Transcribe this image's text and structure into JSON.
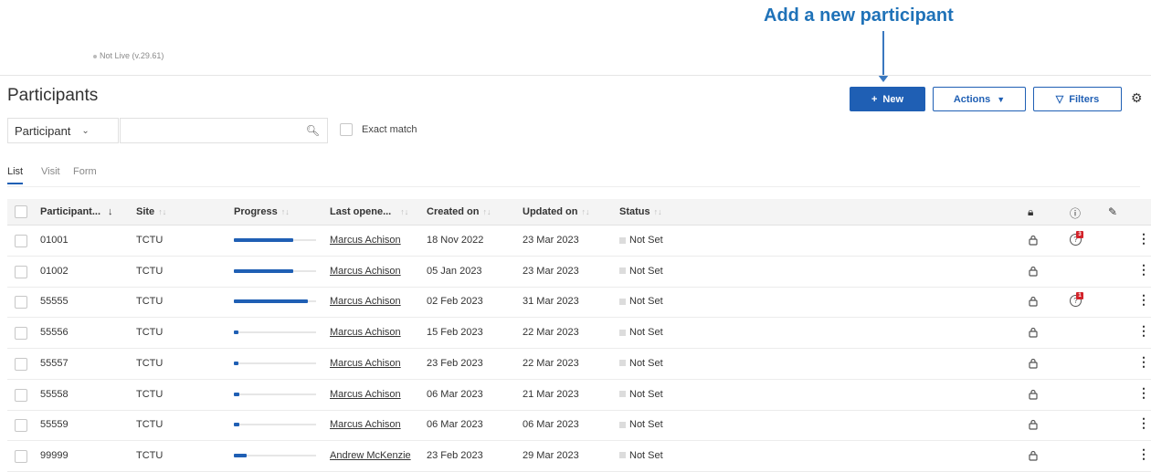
{
  "annotation": {
    "text": "Add a new participant"
  },
  "env": {
    "status": "Not Live (v.29.61)"
  },
  "page": {
    "title": "Participants"
  },
  "toolbar": {
    "new_label": "New",
    "new_icon": "+",
    "actions_label": "Actions",
    "filters_label": "Filters"
  },
  "search": {
    "field_label": "Participant",
    "value": "",
    "exact_label": "Exact match"
  },
  "tabs": [
    "List",
    "Visit",
    "Form"
  ],
  "table": {
    "columns": [
      "Participant...",
      "Site",
      "Progress",
      "Last opene...",
      "Created on",
      "Updated on",
      "Status"
    ],
    "rows": [
      {
        "id": "01001",
        "site": "TCTU",
        "progress": 0.72,
        "last_opened": "Marcus Achison",
        "created": "18 Nov 2022",
        "updated": "23 Mar 2023",
        "status": "Not Set",
        "query_count": "3"
      },
      {
        "id": "01002",
        "site": "TCTU",
        "progress": 0.72,
        "last_opened": "Marcus Achison",
        "created": "05 Jan 2023",
        "updated": "23 Mar 2023",
        "status": "Not Set",
        "query_count": ""
      },
      {
        "id": "55555",
        "site": "TCTU",
        "progress": 0.9,
        "last_opened": "Marcus Achison",
        "created": "02 Feb 2023",
        "updated": "31 Mar 2023",
        "status": "Not Set",
        "query_count": "1"
      },
      {
        "id": "55556",
        "site": "TCTU",
        "progress": 0.05,
        "last_opened": "Marcus Achison",
        "created": "15 Feb 2023",
        "updated": "22 Mar 2023",
        "status": "Not Set",
        "query_count": ""
      },
      {
        "id": "55557",
        "site": "TCTU",
        "progress": 0.05,
        "last_opened": "Marcus Achison",
        "created": "23 Feb 2023",
        "updated": "22 Mar 2023",
        "status": "Not Set",
        "query_count": ""
      },
      {
        "id": "55558",
        "site": "TCTU",
        "progress": 0.07,
        "last_opened": "Marcus Achison",
        "created": "06 Mar 2023",
        "updated": "21 Mar 2023",
        "status": "Not Set",
        "query_count": ""
      },
      {
        "id": "55559",
        "site": "TCTU",
        "progress": 0.07,
        "last_opened": "Marcus Achison",
        "created": "06 Mar 2023",
        "updated": "06 Mar 2023",
        "status": "Not Set",
        "query_count": ""
      },
      {
        "id": "99999",
        "site": "TCTU",
        "progress": 0.16,
        "last_opened": "Andrew McKenzie",
        "created": "23 Feb 2023",
        "updated": "29 Mar 2023",
        "status": "Not Set",
        "query_count": ""
      }
    ]
  },
  "colors": {
    "primary": "#1f5fb4",
    "annotation": "#1f72b8",
    "badge": "#d2232a"
  }
}
